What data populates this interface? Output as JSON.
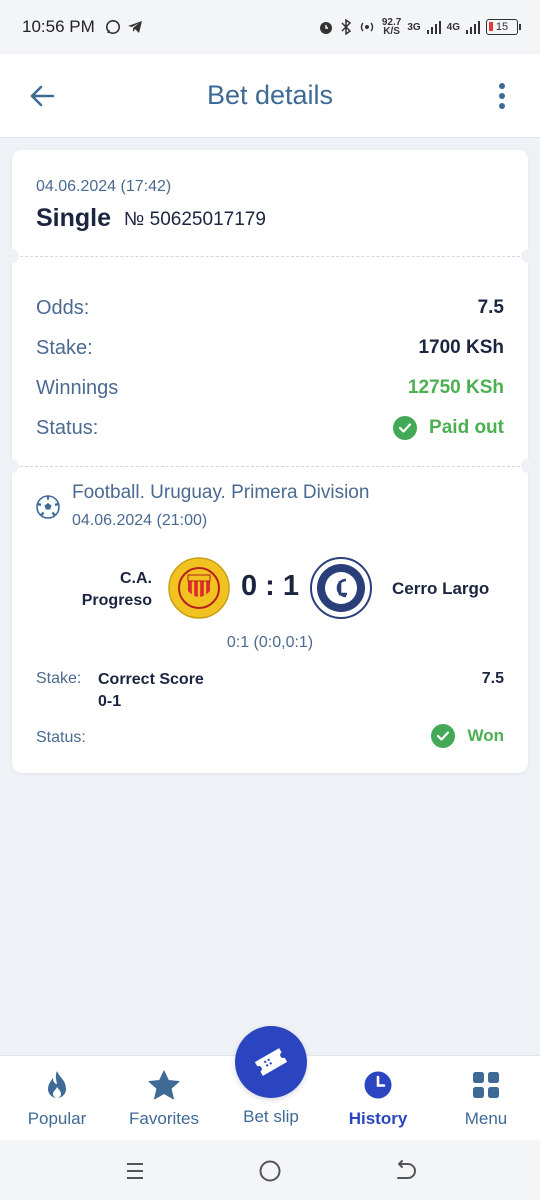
{
  "status_bar": {
    "time": "10:56 PM",
    "speed_value": "92.7",
    "speed_unit": "K/S",
    "net1": "3G",
    "net2": "4G",
    "battery": "15"
  },
  "header": {
    "title": "Bet details"
  },
  "bet": {
    "date": "04.06.2024 (17:42)",
    "type": "Single",
    "number": "№ 50625017179"
  },
  "summary": {
    "odds_label": "Odds:",
    "odds_value": "7.5",
    "stake_label": "Stake:",
    "stake_value": "1700 KSh",
    "winnings_label": "Winnings",
    "winnings_value": "12750 KSh",
    "status_label": "Status:",
    "status_value": "Paid out"
  },
  "event": {
    "league": "Football. Uruguay. Primera Division",
    "date": "04.06.2024 (21:00)",
    "team1_line1": "C.A.",
    "team1_line2": "Progreso",
    "team2": "Cerro Largo",
    "score": "0 : 1",
    "score_detail": "0:1 (0:0,0:1)",
    "stake_label": "Stake:",
    "selection_line1": "Correct Score",
    "selection_line2": "0-1",
    "selection_odds": "7.5",
    "status_label": "Status:",
    "status_value": "Won"
  },
  "bottom_nav": {
    "popular": "Popular",
    "favorites": "Favorites",
    "bet_slip": "Bet slip",
    "history": "History",
    "menu": "Menu"
  },
  "colors": {
    "accent": "#2b45c0",
    "title_blue": "#3f6a96",
    "success": "#43a956",
    "background": "#eef1f5"
  }
}
